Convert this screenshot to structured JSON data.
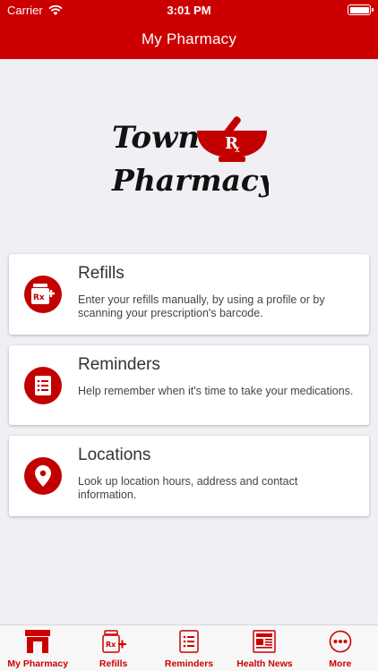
{
  "status_bar": {
    "carrier": "Carrier",
    "time": "3:01 PM"
  },
  "nav": {
    "title": "My Pharmacy"
  },
  "logo": {
    "line1": "Town",
    "line2": "Pharmacy",
    "rx": "R"
  },
  "cards": [
    {
      "icon": "rx-bottle-plus-icon",
      "title": "Refills",
      "description": "Enter your refills manually, by using a profile or by scanning your prescription's barcode."
    },
    {
      "icon": "list-icon",
      "title": "Reminders",
      "description": "Help remember when it's time to take your medications."
    },
    {
      "icon": "location-pin-icon",
      "title": "Locations",
      "description": "Look up location hours, address and contact information."
    }
  ],
  "tabbar": {
    "items": [
      {
        "label": "My Pharmacy",
        "icon": "storefront-icon"
      },
      {
        "label": "Refills",
        "icon": "rx-bottle-plus-icon"
      },
      {
        "label": "Reminders",
        "icon": "list-icon"
      },
      {
        "label": "Health News",
        "icon": "newspaper-icon"
      },
      {
        "label": "More",
        "icon": "more-icon"
      }
    ]
  },
  "colors": {
    "brand": "#cc0000",
    "background": "#efeff4",
    "card": "#ffffff"
  }
}
